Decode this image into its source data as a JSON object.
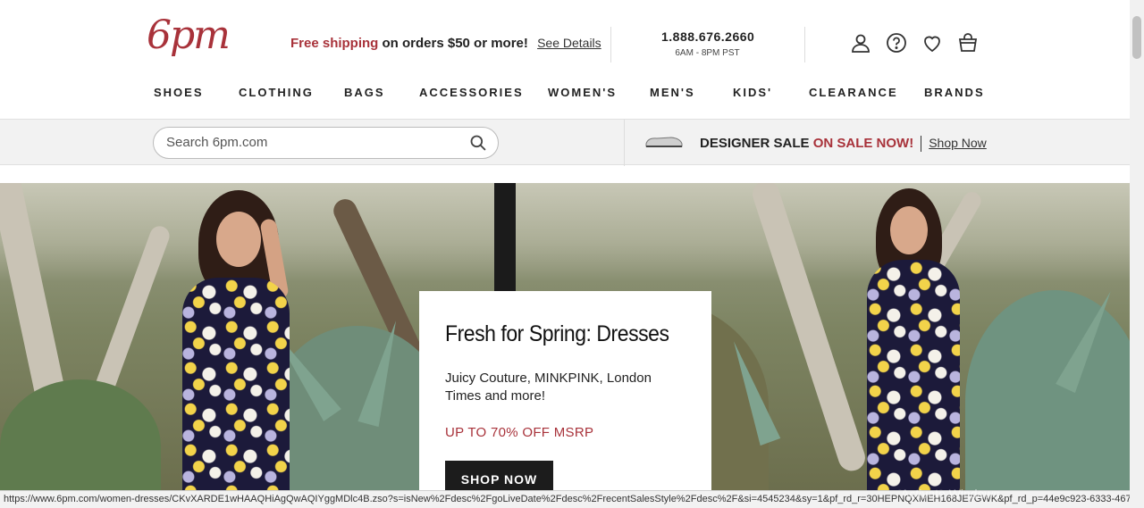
{
  "brand": {
    "logo": "6pm",
    "color": "#a8323a"
  },
  "promo": {
    "highlight": "Free shipping",
    "rest": " on orders $50 or more!",
    "details": "See Details"
  },
  "contact": {
    "phone": "1.888.676.2660",
    "hours": "6AM - 8PM PST"
  },
  "header_icons": [
    "account-icon",
    "help-icon",
    "favorites-heart-icon",
    "shopping-bag-icon"
  ],
  "nav": [
    "SHOES",
    "CLOTHING",
    "BAGS",
    "ACCESSORIES",
    "WOMEN'S",
    "MEN'S",
    "KIDS'",
    "CLEARANCE",
    "BRANDS"
  ],
  "search": {
    "placeholder": "Search 6pm.com"
  },
  "sale_banner": {
    "lead": "DESIGNER SALE",
    "highlight": "ON SALE NOW!",
    "link": "Shop Now"
  },
  "hero": {
    "title": "Fresh for Spring: Dresses",
    "description": "Juicy Couture, MINKPINK, London Times and more!",
    "offer": "UP TO 70% OFF MSRP",
    "cta": "SHOP NOW"
  },
  "status_url": "https://www.6pm.com/women-dresses/CKvXARDE1wHAAQHiAgQwAQIYggMDlc4B.zso?s=isNew%2Fdesc%2FgoLiveDate%2Fdesc%2FrecentSalesStyle%2Fdesc%2F&si=4545234&sy=1&pf_rd_r=30HEPNQXMEH168JE7GWK&pf_rd_p=44e9c923-6333-467...",
  "watermark": "Activate Windows"
}
